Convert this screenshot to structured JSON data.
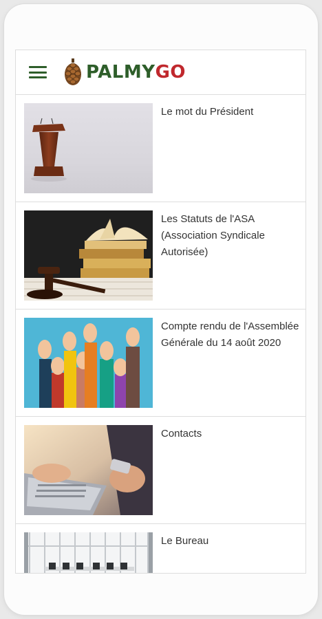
{
  "brand": {
    "name_part1": "PALMY",
    "name_part2": "GO",
    "color_primary": "#2e5e2a",
    "color_accent": "#c0282d"
  },
  "header": {
    "menu_icon": "hamburger-menu-icon",
    "logo_icon": "pinecone-logo-icon"
  },
  "articles": [
    {
      "title": "Le mot du Président",
      "image": "podium-with-microphones"
    },
    {
      "title": "Les Statuts de l'ASA (Association Syndicale Autorisée)",
      "image": "gavel-and-books"
    },
    {
      "title": "Compte rendu de l'Assemblée Générale du 14 août 2020",
      "image": "raised-hands-vote"
    },
    {
      "title": "Contacts",
      "image": "hands-typing-laptop-holding-phone"
    },
    {
      "title": "Le Bureau",
      "image": "empty-conference-room"
    }
  ]
}
